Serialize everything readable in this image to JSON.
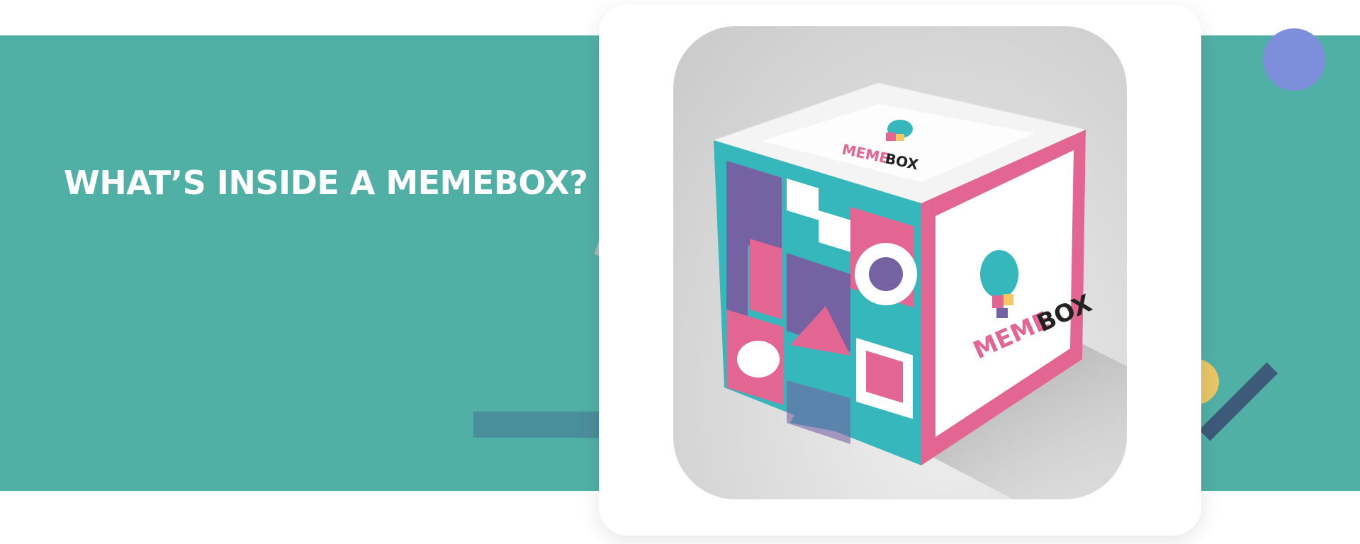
{
  "section": {
    "heading": "WHAT’S INSIDE A MEMEBOX?"
  },
  "product_image": {
    "brand_mark_prefix": "MEME",
    "brand_mark_suffix": "BOX",
    "icon": "elephant-mascot-icon"
  },
  "colors": {
    "band": "#51b0a5",
    "heading": "#ffffff",
    "box_teal": "#35b7bc",
    "box_pink": "#e26592",
    "box_purple": "#7462a3",
    "accent_yellow": "#f6c863",
    "accent_navy": "#3c5a7a"
  }
}
